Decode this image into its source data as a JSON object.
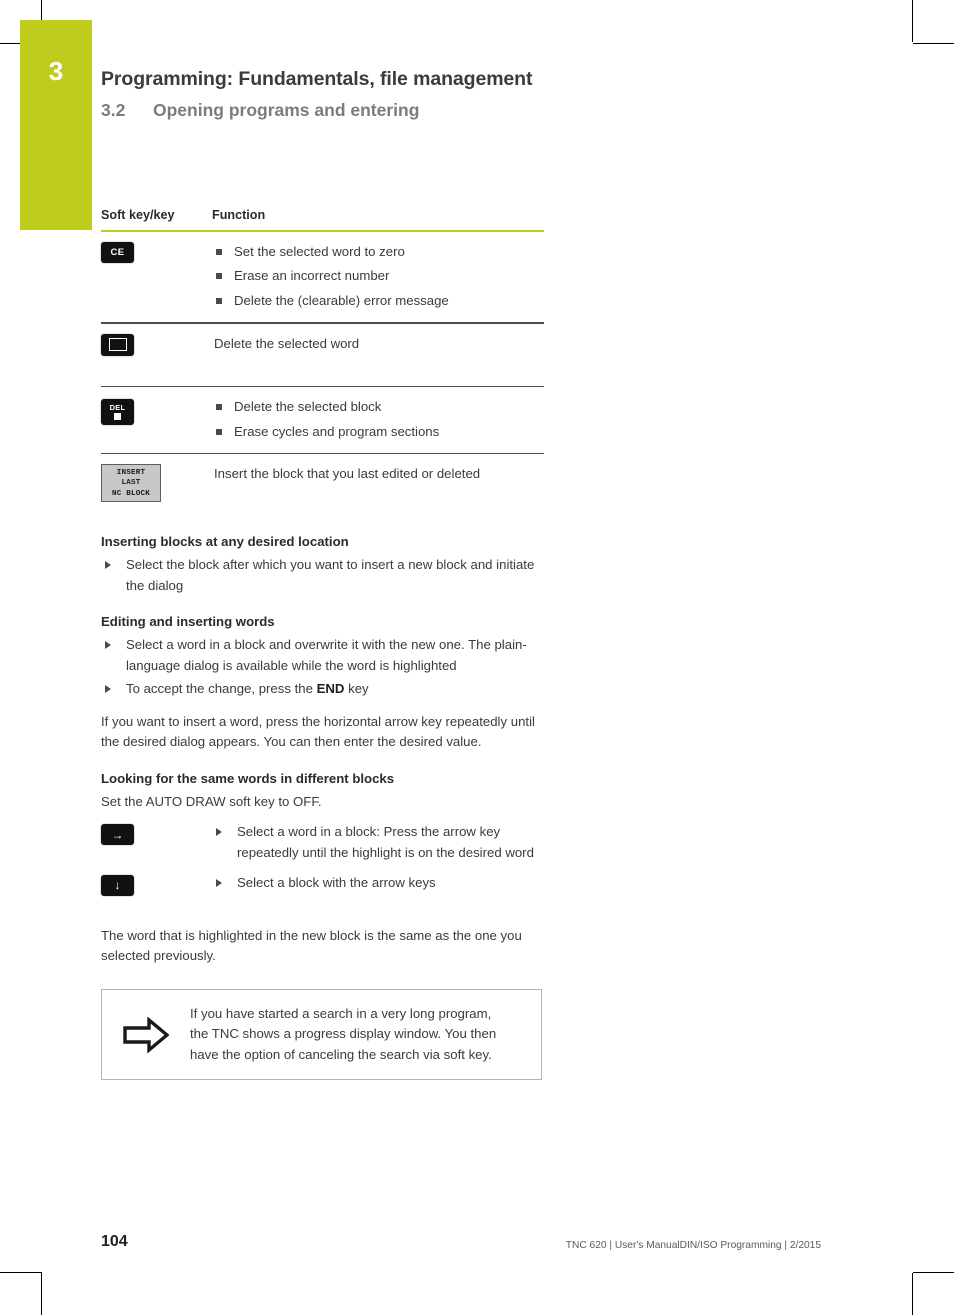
{
  "page": {
    "chapter_number": "3",
    "title": "Programming: Fundamentals, file management",
    "section_number": "3.2",
    "section_title": "Opening programs and entering",
    "accent_color": "#bfcc1e"
  },
  "softkey_table": {
    "header": {
      "col_key": "Soft key/key",
      "col_function": "Function"
    },
    "rows": [
      {
        "key_label": "CE",
        "key_icon": "ce-key-icon",
        "functions": [
          "Set the selected word to zero",
          "Erase an incorrect number",
          "Delete the (clearable) error message"
        ]
      },
      {
        "key_label": "",
        "key_icon": "no-ent-key-icon",
        "functions": [
          "Delete the selected word"
        ],
        "single_line": true
      },
      {
        "key_label": "DEL",
        "key_icon": "del-key-icon",
        "functions": [
          "Delete the selected block",
          "Erase cycles and program sections"
        ]
      },
      {
        "key_label": "INSERT LAST NC BLOCK",
        "key_icon": "insert-last-nc-block-softkey",
        "softkey_lines": [
          "INSERT",
          "LAST",
          "NC BLOCK"
        ],
        "functions": [
          "Insert the block that you last edited or deleted"
        ],
        "single_line": true
      }
    ]
  },
  "sections": [
    {
      "heading": "Inserting blocks at any desired location",
      "steps": [
        "Select the block after which you want to insert a new block and initiate the dialog"
      ]
    },
    {
      "heading": "Editing and inserting words",
      "steps_rich": [
        {
          "before": "Select a word in a block and overwrite it with the new one. The plain-language dialog is available while the word is highlighted",
          "bold": "",
          "after": ""
        },
        {
          "before": "To accept the change, press the ",
          "bold": "END",
          "after": " key"
        }
      ]
    }
  ],
  "paragraph_after_editing": "If you want to insert a word, press the horizontal arrow key repeatedly until the desired dialog appears. You can then enter the desired value.",
  "looking_section": {
    "heading": "Looking for the same words in different blocks",
    "intro": "Set the AUTO DRAW soft key to OFF.",
    "key_steps": [
      {
        "key_icon": "arrow-right-key-icon",
        "glyph": "→",
        "text": "Select a word in a block: Press the arrow key repeatedly until the highlight is on the desired word"
      },
      {
        "key_icon": "arrow-down-key-icon",
        "glyph": "↓",
        "text": "Select a block with the arrow keys"
      }
    ]
  },
  "closing_paragraph": "The word that is highlighted in the new block is the same as the one you selected previously.",
  "note": {
    "icon": "block-arrow-right-icon",
    "lines": [
      "If you have started a search in a very long program,",
      "the TNC shows a progress display window. You then",
      "have the option of canceling the search via soft key."
    ]
  },
  "footer": {
    "page_number": "104",
    "meta": "TNC 620 | User's ManualDIN/ISO Programming | 2/2015"
  }
}
